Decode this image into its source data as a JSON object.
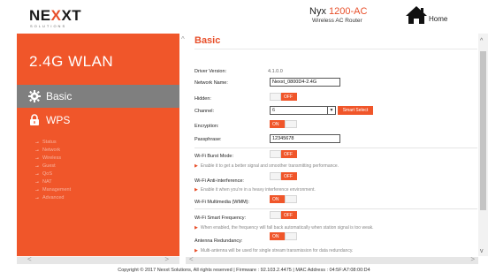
{
  "header": {
    "logo_left": "NE",
    "logo_x": "X",
    "logo_right": "XT",
    "logo_sub": "SOLUTIONS",
    "model_name": "Nyx",
    "model_num": "1200-AC",
    "model_sub": "Wireless AC Router",
    "home_label": "Home"
  },
  "sidebar": {
    "title": "2.4G WLAN",
    "items": [
      {
        "label": "Basic",
        "icon": "gear-icon",
        "active": true
      },
      {
        "label": "WPS",
        "icon": "lock-icon",
        "active": false
      }
    ],
    "sub_links": [
      "Status",
      "Network",
      "Wireless",
      "Guest",
      "QoS",
      "NAT",
      "Management",
      "Advanced"
    ]
  },
  "main": {
    "title": "Basic",
    "driver_version_label": "Driver Version:",
    "driver_version_value": "4.1.0.0",
    "network_name_label": "Network Name:",
    "network_name_value": "Nexxt_0800D4-2.4G",
    "hidden_label": "Hidden:",
    "hidden_state": "OFF",
    "channel_label": "Channel:",
    "channel_value": "6",
    "smart_select_label": "Smart Select",
    "encryption_label": "Encryption:",
    "encryption_state": "ON",
    "passphrase_label": "Passphrase:",
    "passphrase_value": "12345678",
    "burst_label": "Wi-Fi Burst Mode:",
    "burst_state": "OFF",
    "burst_hint": "Enable it to get a better signal and smoother transmitting performance.",
    "anti_label": "Wi-Fi Anti-interference:",
    "anti_state": "OFF",
    "anti_hint": "Enable it when you're in a heavy interference environment.",
    "wmm_label": "Wi-Fi Multimedia (WMM):",
    "wmm_state": "ON",
    "smart_freq_label": "Wi-Fi Smart Frequency:",
    "smart_freq_state": "OFF",
    "smart_freq_hint": "When enabled, the frequency will fall back automatically when station signal is too weak.",
    "antenna_label": "Antenna Redundancy:",
    "antenna_state": "ON",
    "antenna_hint": "Multi-antenna will be used for single stream transmission for data redundancy."
  },
  "footer": {
    "text": "Copyright © 2017 Nexxt Solutions, All rights reserved  |  Firmware : 92.103.2.4475  |  MAC Address : 04:5F:A7:08:00:D4"
  },
  "colors": {
    "accent": "#f0562a",
    "active_nav": "#7f7f7f"
  }
}
